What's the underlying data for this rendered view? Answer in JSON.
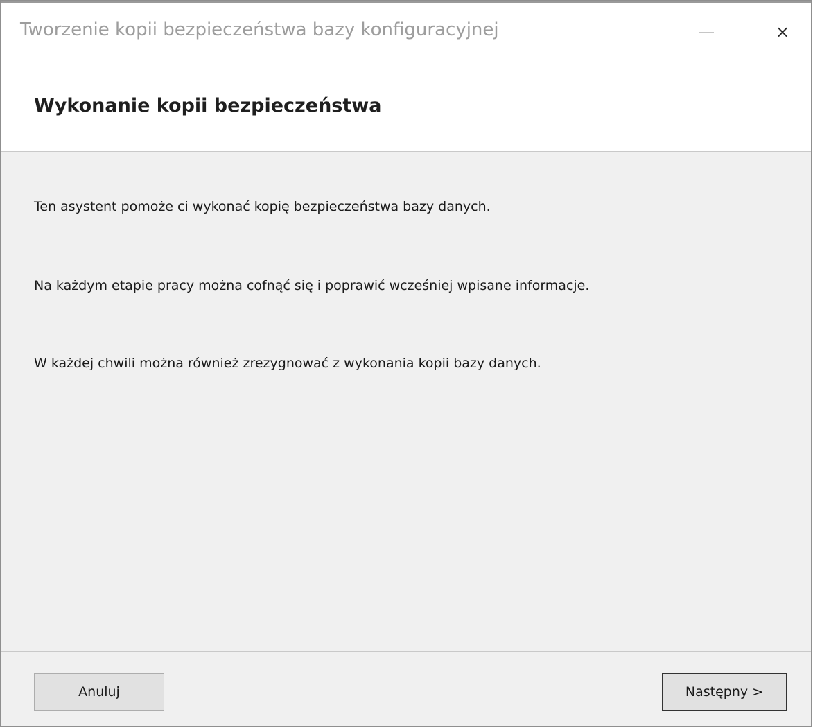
{
  "window": {
    "title": "Tworzenie kopii bezpieczeństwa bazy konfiguracyjnej",
    "minimize_label": "",
    "close_label": "×"
  },
  "header": {
    "title": "Wykonanie kopii bezpieczeństwa"
  },
  "content": {
    "paragraphs": [
      "Ten asystent pomoże ci wykonać kopię bezpieczeństwa bazy danych.",
      "Na każdym etapie pracy można cofnąć się i poprawić wcześniej wpisane informacje.",
      "W każdej chwili można również zrezygnować z wykonania kopii bazy danych."
    ]
  },
  "footer": {
    "cancel_label": "Anuluj",
    "next_label": "Następny >"
  },
  "colors": {
    "title_text": "#9d9d9d",
    "dialog_bg": "#f0f0f0",
    "header_bg": "#ffffff",
    "button_bg": "#e1e1e1"
  }
}
